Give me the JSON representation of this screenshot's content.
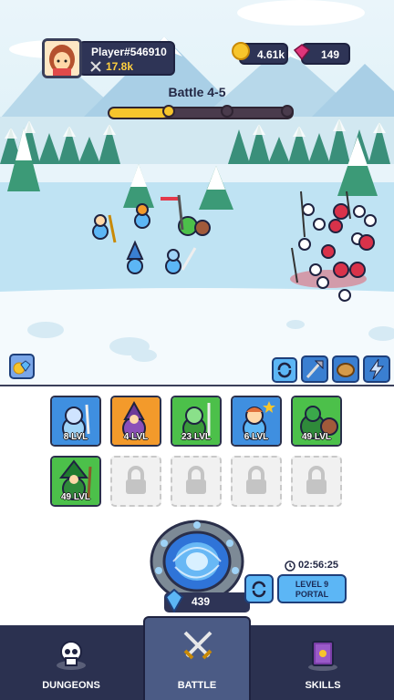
{
  "player": {
    "name": "Player#546910",
    "power": "17.8k",
    "avatar_icon": "girl-avatar"
  },
  "currency": {
    "gold": "4.61k",
    "gems": "149"
  },
  "battle": {
    "title": "Battle 4-5",
    "progress": 0.32
  },
  "heroes": [
    {
      "level": "8 LVL",
      "color": "#3f8fe0",
      "icon": "knight-icon"
    },
    {
      "level": "4 LVL",
      "color": "#f39a2b",
      "icon": "mage-icon"
    },
    {
      "level": "23 LVL",
      "color": "#4cc04a",
      "icon": "viking-icon"
    },
    {
      "level": "6 LVL",
      "color": "#3f8fe0",
      "icon": "wand-girl-icon"
    },
    {
      "level": "49 LVL",
      "color": "#4cc04a",
      "icon": "orc-icon"
    },
    {
      "level": "49 LVL",
      "color": "#4cc04a",
      "icon": "wizard-icon"
    }
  ],
  "portal": {
    "count": "439",
    "timer": "02:56:25",
    "level_button": "LEVEL 9\nPORTAL"
  },
  "nav": {
    "dungeons": "DUNGEONS",
    "battle": "BATTLE",
    "skills": "SKILLS"
  },
  "colors": {
    "nav_bg": "#2b3150",
    "nav_active": "#4b5b85",
    "accent_blue": "#5cb6f5",
    "gold": "#f7c52c"
  }
}
